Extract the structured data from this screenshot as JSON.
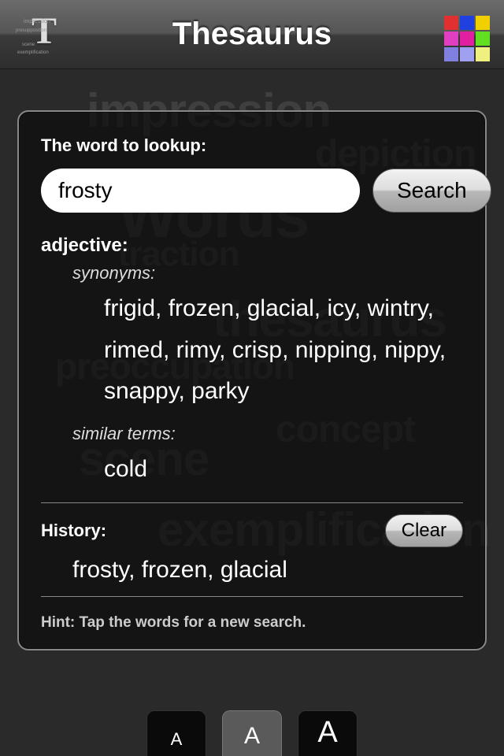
{
  "header": {
    "title": "Thesaurus"
  },
  "colors": {
    "grid": [
      "#e03030",
      "#2040e0",
      "#f0d000",
      "#e040c0",
      "#e020a0",
      "#60e020",
      "#8080e0",
      "#a0a0f0",
      "#f0f080"
    ]
  },
  "ghost": {
    "w1": "impression",
    "w2": "depiction",
    "w3": "Words",
    "w4": "traction",
    "w5": "thesaurus",
    "w6": "preoccupation",
    "w7": "concept",
    "w8": "scene",
    "w9": "exemplification"
  },
  "search": {
    "label": "The word to lookup:",
    "value": "frosty",
    "button": "Search"
  },
  "results": {
    "pos": "adjective:",
    "synonyms_label": "synonyms:",
    "synonyms": "frigid, frozen, glacial, icy, wintry, rimed, rimy, crisp, nipping, nippy, snappy, parky",
    "similar_label": "similar terms:",
    "similar": "cold"
  },
  "history": {
    "label": "History:",
    "clear": "Clear",
    "items": "frosty, frozen, glacial"
  },
  "hint": "Hint: Tap the words for a new search.",
  "font_buttons": {
    "small": "A",
    "medium": "A",
    "large": "A"
  }
}
